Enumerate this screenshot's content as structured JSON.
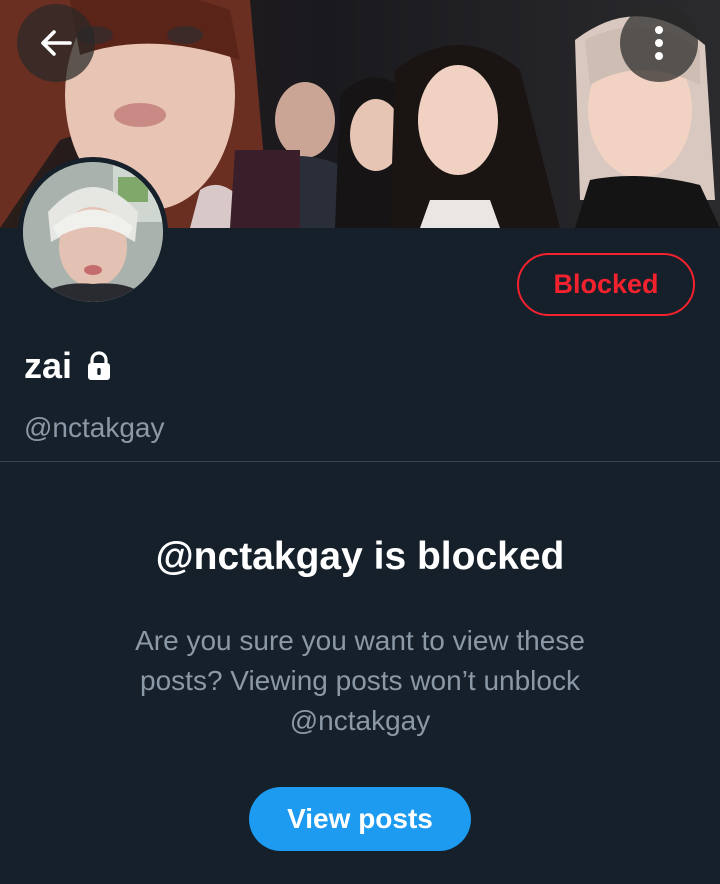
{
  "header": {
    "back_icon": "arrow-left-icon",
    "more_icon": "more-vertical-icon"
  },
  "profile": {
    "display_name": "zai",
    "lock_icon": "lock-icon",
    "handle": "@nctakgay",
    "blocked_label": "Blocked"
  },
  "blocked_notice": {
    "title": "@nctakgay is blocked",
    "description": "Are you sure you want to view these posts? Viewing posts won’t unblock",
    "mention": "@nctakgay",
    "view_posts_label": "View posts"
  },
  "colors": {
    "background": "#15202b",
    "accent": "#1d9bf0",
    "blocked_red": "#f4212e",
    "secondary_text": "#8b98a5",
    "divider": "#38444d"
  }
}
